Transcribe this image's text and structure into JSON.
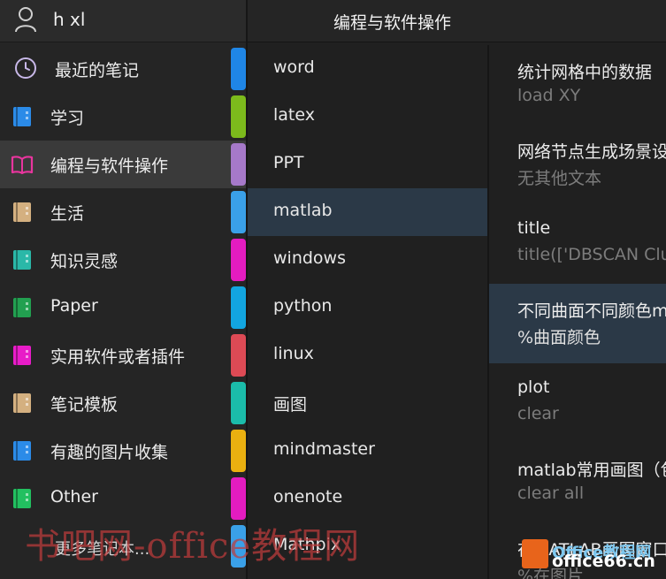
{
  "user": {
    "name": "h xl"
  },
  "header": {
    "title": "编程与软件操作"
  },
  "notebooks": [
    {
      "label": "最近的笔记",
      "icon": "clock-icon",
      "color": "#c8b8e8"
    },
    {
      "label": "学习",
      "icon": "notebook-icon",
      "color": "#2b8be8"
    },
    {
      "label": "编程与软件操作",
      "icon": "open-book-icon",
      "color": "#e8359e",
      "selected": true
    },
    {
      "label": "生活",
      "icon": "notebook-icon",
      "color": "#d4b080"
    },
    {
      "label": "知识灵感",
      "icon": "notebook-icon",
      "color": "#2ab8a8"
    },
    {
      "label": "Paper",
      "icon": "notebook-icon",
      "color": "#22a050"
    },
    {
      "label": "实用软件或者插件",
      "icon": "notebook-icon",
      "color": "#e81cc8"
    },
    {
      "label": "笔记模板",
      "icon": "notebook-icon",
      "color": "#d4b080"
    },
    {
      "label": "有趣的图片收集",
      "icon": "notebook-icon",
      "color": "#2b8be8"
    },
    {
      "label": "Other",
      "icon": "notebook-icon",
      "color": "#22c060"
    }
  ],
  "more_notebooks": "更多笔记本...",
  "sections": [
    {
      "label": "word",
      "color": "#1f86e6"
    },
    {
      "label": "latex",
      "color": "#7cba1c"
    },
    {
      "label": "PPT",
      "color": "#a679c9"
    },
    {
      "label": "matlab",
      "color": "#3aa0e8",
      "selected": true
    },
    {
      "label": "windows",
      "color": "#e41cc0"
    },
    {
      "label": "python",
      "color": "#12a5e0"
    },
    {
      "label": "linux",
      "color": "#dd4a55"
    },
    {
      "label": "画图",
      "color": "#1bbcaa"
    },
    {
      "label": "mindmaster",
      "color": "#eab010"
    },
    {
      "label": "onenote",
      "color": "#e41cc0"
    },
    {
      "label": "Mathpix",
      "color": "#3aa0e8"
    }
  ],
  "pages": [
    {
      "title": "统计网格中的数据",
      "preview": "load XY"
    },
    {
      "title": "网络节点生成场景设",
      "preview": "无其他文本"
    },
    {
      "title": "title",
      "preview": "title(['DBSCAN Clu"
    },
    {
      "title": "不同曲面不同颜色m",
      "preview": "%曲面颜色",
      "selected": true
    },
    {
      "title": "plot",
      "preview": "clear"
    },
    {
      "title": "matlab常用画图（包",
      "preview": "clear all"
    },
    {
      "title": "在MATLAB画图窗口",
      "preview": "%在图片"
    }
  ],
  "watermark": {
    "text": "书吧网-office教程网"
  },
  "logo": {
    "text": "Office教程网",
    "domain": "office66.cn"
  }
}
